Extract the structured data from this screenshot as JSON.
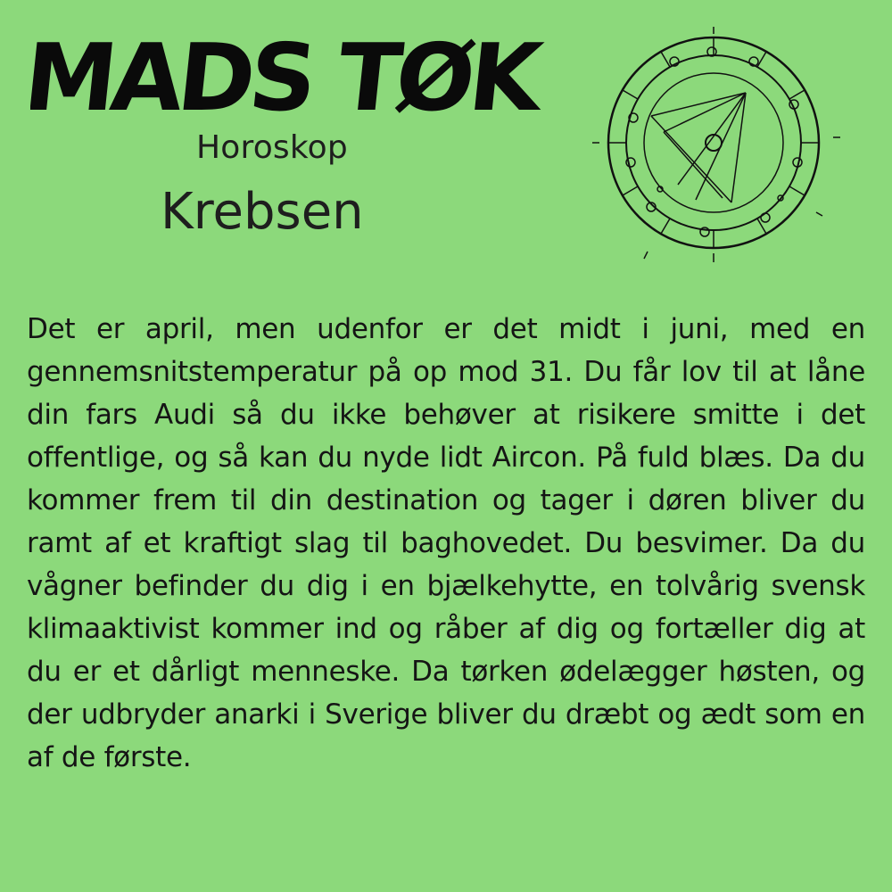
{
  "header": {
    "logo_text": "MADS TØK",
    "subtitle": "Horoskop",
    "sign": "Krebsen"
  },
  "chart_icon": "astrology-chart-wheel-icon",
  "colors": {
    "background": "#8cd97b",
    "text": "#151515"
  },
  "body": {
    "text": "Det er april, men udenfor er det midt i juni, med en gennemsnitstemperatur på op mod 31. Du får lov til at låne din fars Audi så du ikke behøver at risikere smitte i det offentlige, og så kan du nyde lidt Aircon. På fuld blæs. Da du kommer frem til din destination og tager i døren bliver du ramt af et kraftigt slag til baghovedet. Du besvimer. Da du vågner befinder du dig i en bjælkehytte, en tolvårig svensk klimaaktivist kommer ind og råber af dig og fortæller dig at du er et dårligt menneske. Da tørken ødelægger høsten, og der udbryder anarki i Sverige bliver du dræbt og ædt som en af de første."
  }
}
